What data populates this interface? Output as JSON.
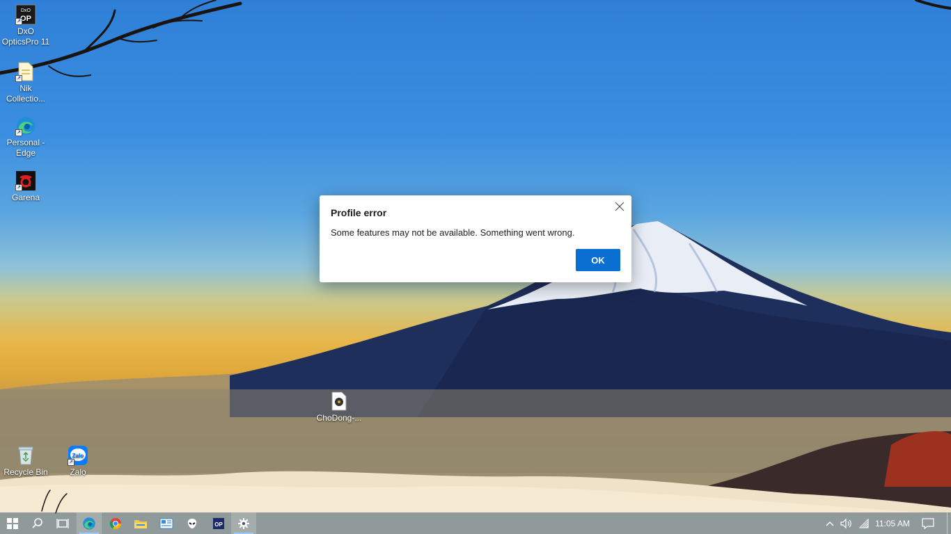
{
  "desktop": {
    "icons": [
      {
        "label": "DxO OpticsPro 11",
        "icon": "dxo-opticspro-icon"
      },
      {
        "label": "Nik Collectio...",
        "icon": "nik-collection-icon"
      },
      {
        "label": "Personal - Edge",
        "icon": "edge-icon"
      },
      {
        "label": "Garena",
        "icon": "garena-icon"
      },
      {
        "label": "ChoDong-...",
        "icon": "media-file-icon"
      },
      {
        "label": "Recycle Bin",
        "icon": "recycle-bin-icon"
      },
      {
        "label": "Zalo",
        "icon": "zalo-icon"
      }
    ],
    "icon_text": {
      "dxo_badge": "DxO",
      "dxo_op": "OP",
      "zalo_badge": "Zalo"
    }
  },
  "dialog": {
    "title": "Profile error",
    "message": "Some features may not be available. Something went wrong.",
    "ok_label": "OK"
  },
  "taskbar": {
    "items": [
      {
        "icon": "start-icon"
      },
      {
        "icon": "search-icon"
      },
      {
        "icon": "task-view-icon"
      },
      {
        "icon": "edge-icon",
        "active": true
      },
      {
        "icon": "chrome-icon"
      },
      {
        "icon": "file-explorer-icon"
      },
      {
        "icon": "photos-app-icon"
      },
      {
        "icon": "alien-app-icon"
      },
      {
        "icon": "dxo-opticspro-icon",
        "badge": "OP"
      },
      {
        "icon": "settings-icon",
        "active": true
      }
    ],
    "clock": "11:05 AM"
  },
  "colors": {
    "accent": "#0a6fd1",
    "taskbar": "#3c5a6e"
  }
}
